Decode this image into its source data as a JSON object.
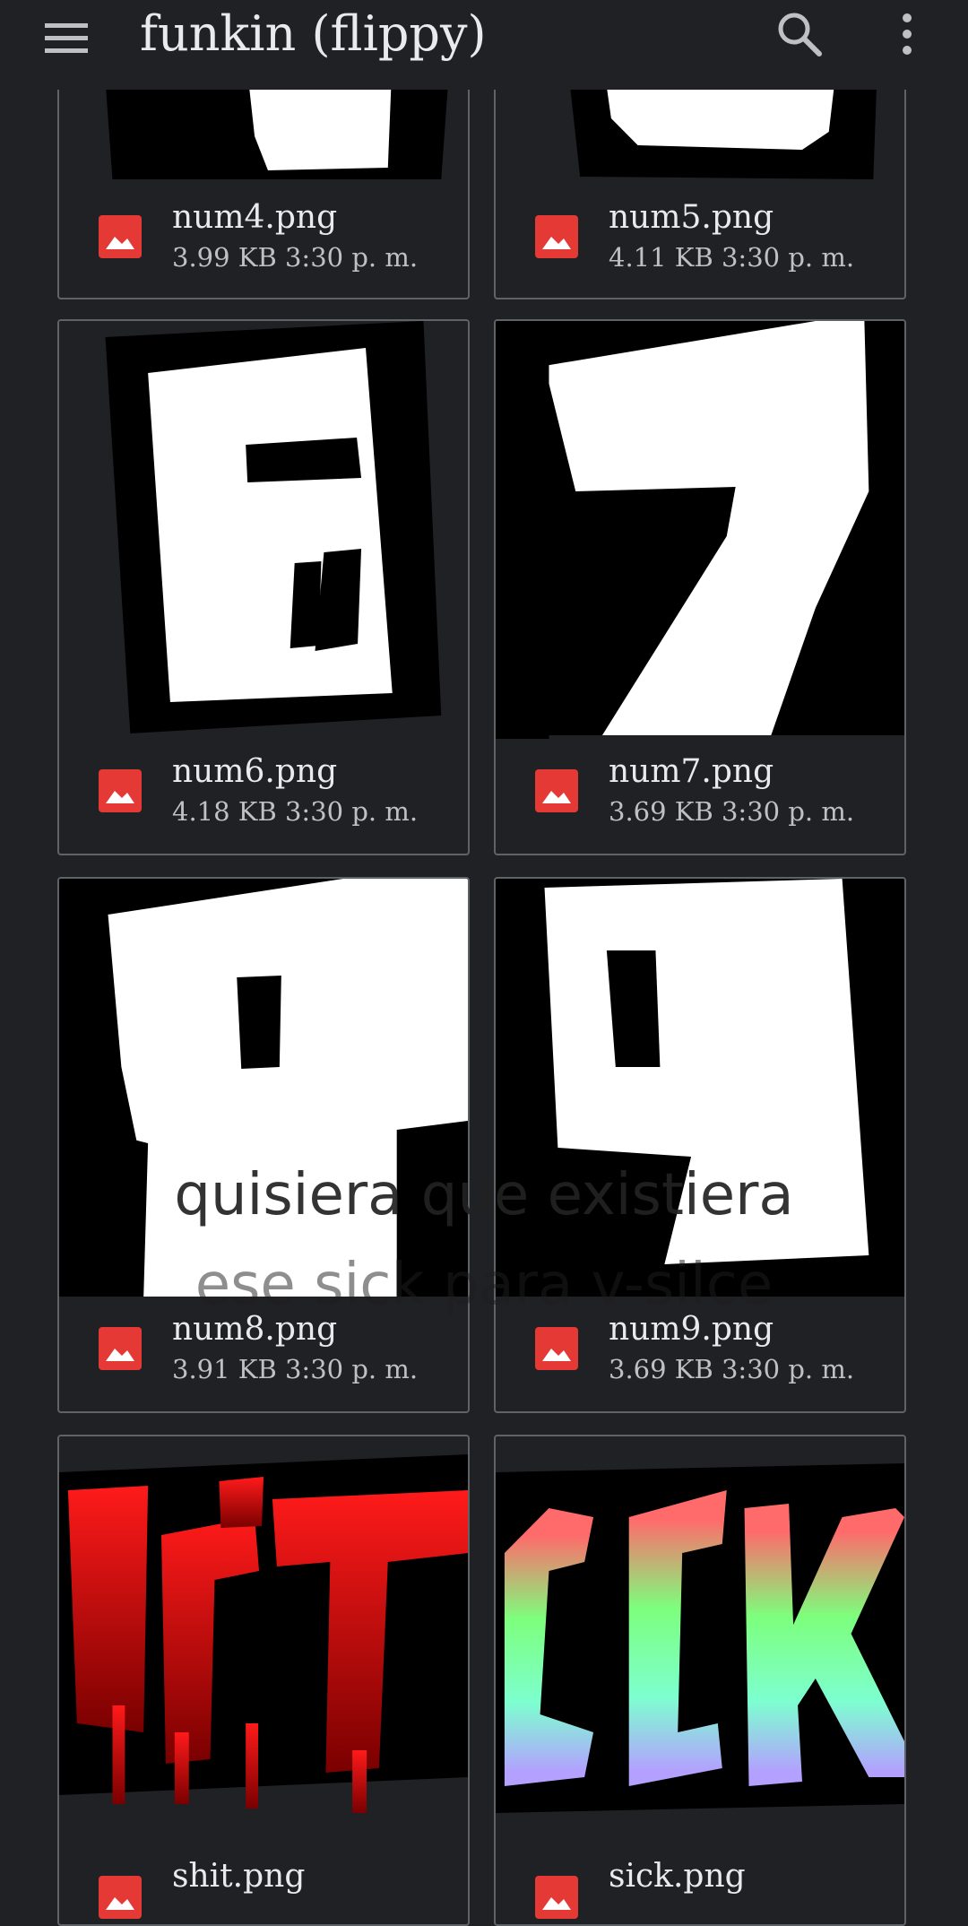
{
  "app": {
    "title": "funkin (flippy)"
  },
  "icons": {
    "menu": "menu-icon",
    "search": "search-icon",
    "more": "more-vert-icon",
    "file": "image-file-icon"
  },
  "colors": {
    "background": "#202124",
    "file_icon": "#e53935",
    "card_border": "#5f6368"
  },
  "files": [
    {
      "name": "num4.png",
      "size": "3.99 KB",
      "time": "3:30 p. m."
    },
    {
      "name": "num5.png",
      "size": "4.11 KB",
      "time": "3:30 p. m."
    },
    {
      "name": "num6.png",
      "size": "4.18 KB",
      "time": "3:30 p. m."
    },
    {
      "name": "num7.png",
      "size": "3.69 KB",
      "time": "3:30 p. m."
    },
    {
      "name": "num8.png",
      "size": "3.91 KB",
      "time": "3:30 p. m."
    },
    {
      "name": "num9.png",
      "size": "3.69 KB",
      "time": "3:30 p. m."
    },
    {
      "name": "shit.png",
      "size": "",
      "time": ""
    },
    {
      "name": "sick.png",
      "size": "",
      "time": ""
    }
  ],
  "overlay_caption": {
    "line1": "quisiera que existiera",
    "line2": "ese sick para v-silce"
  }
}
